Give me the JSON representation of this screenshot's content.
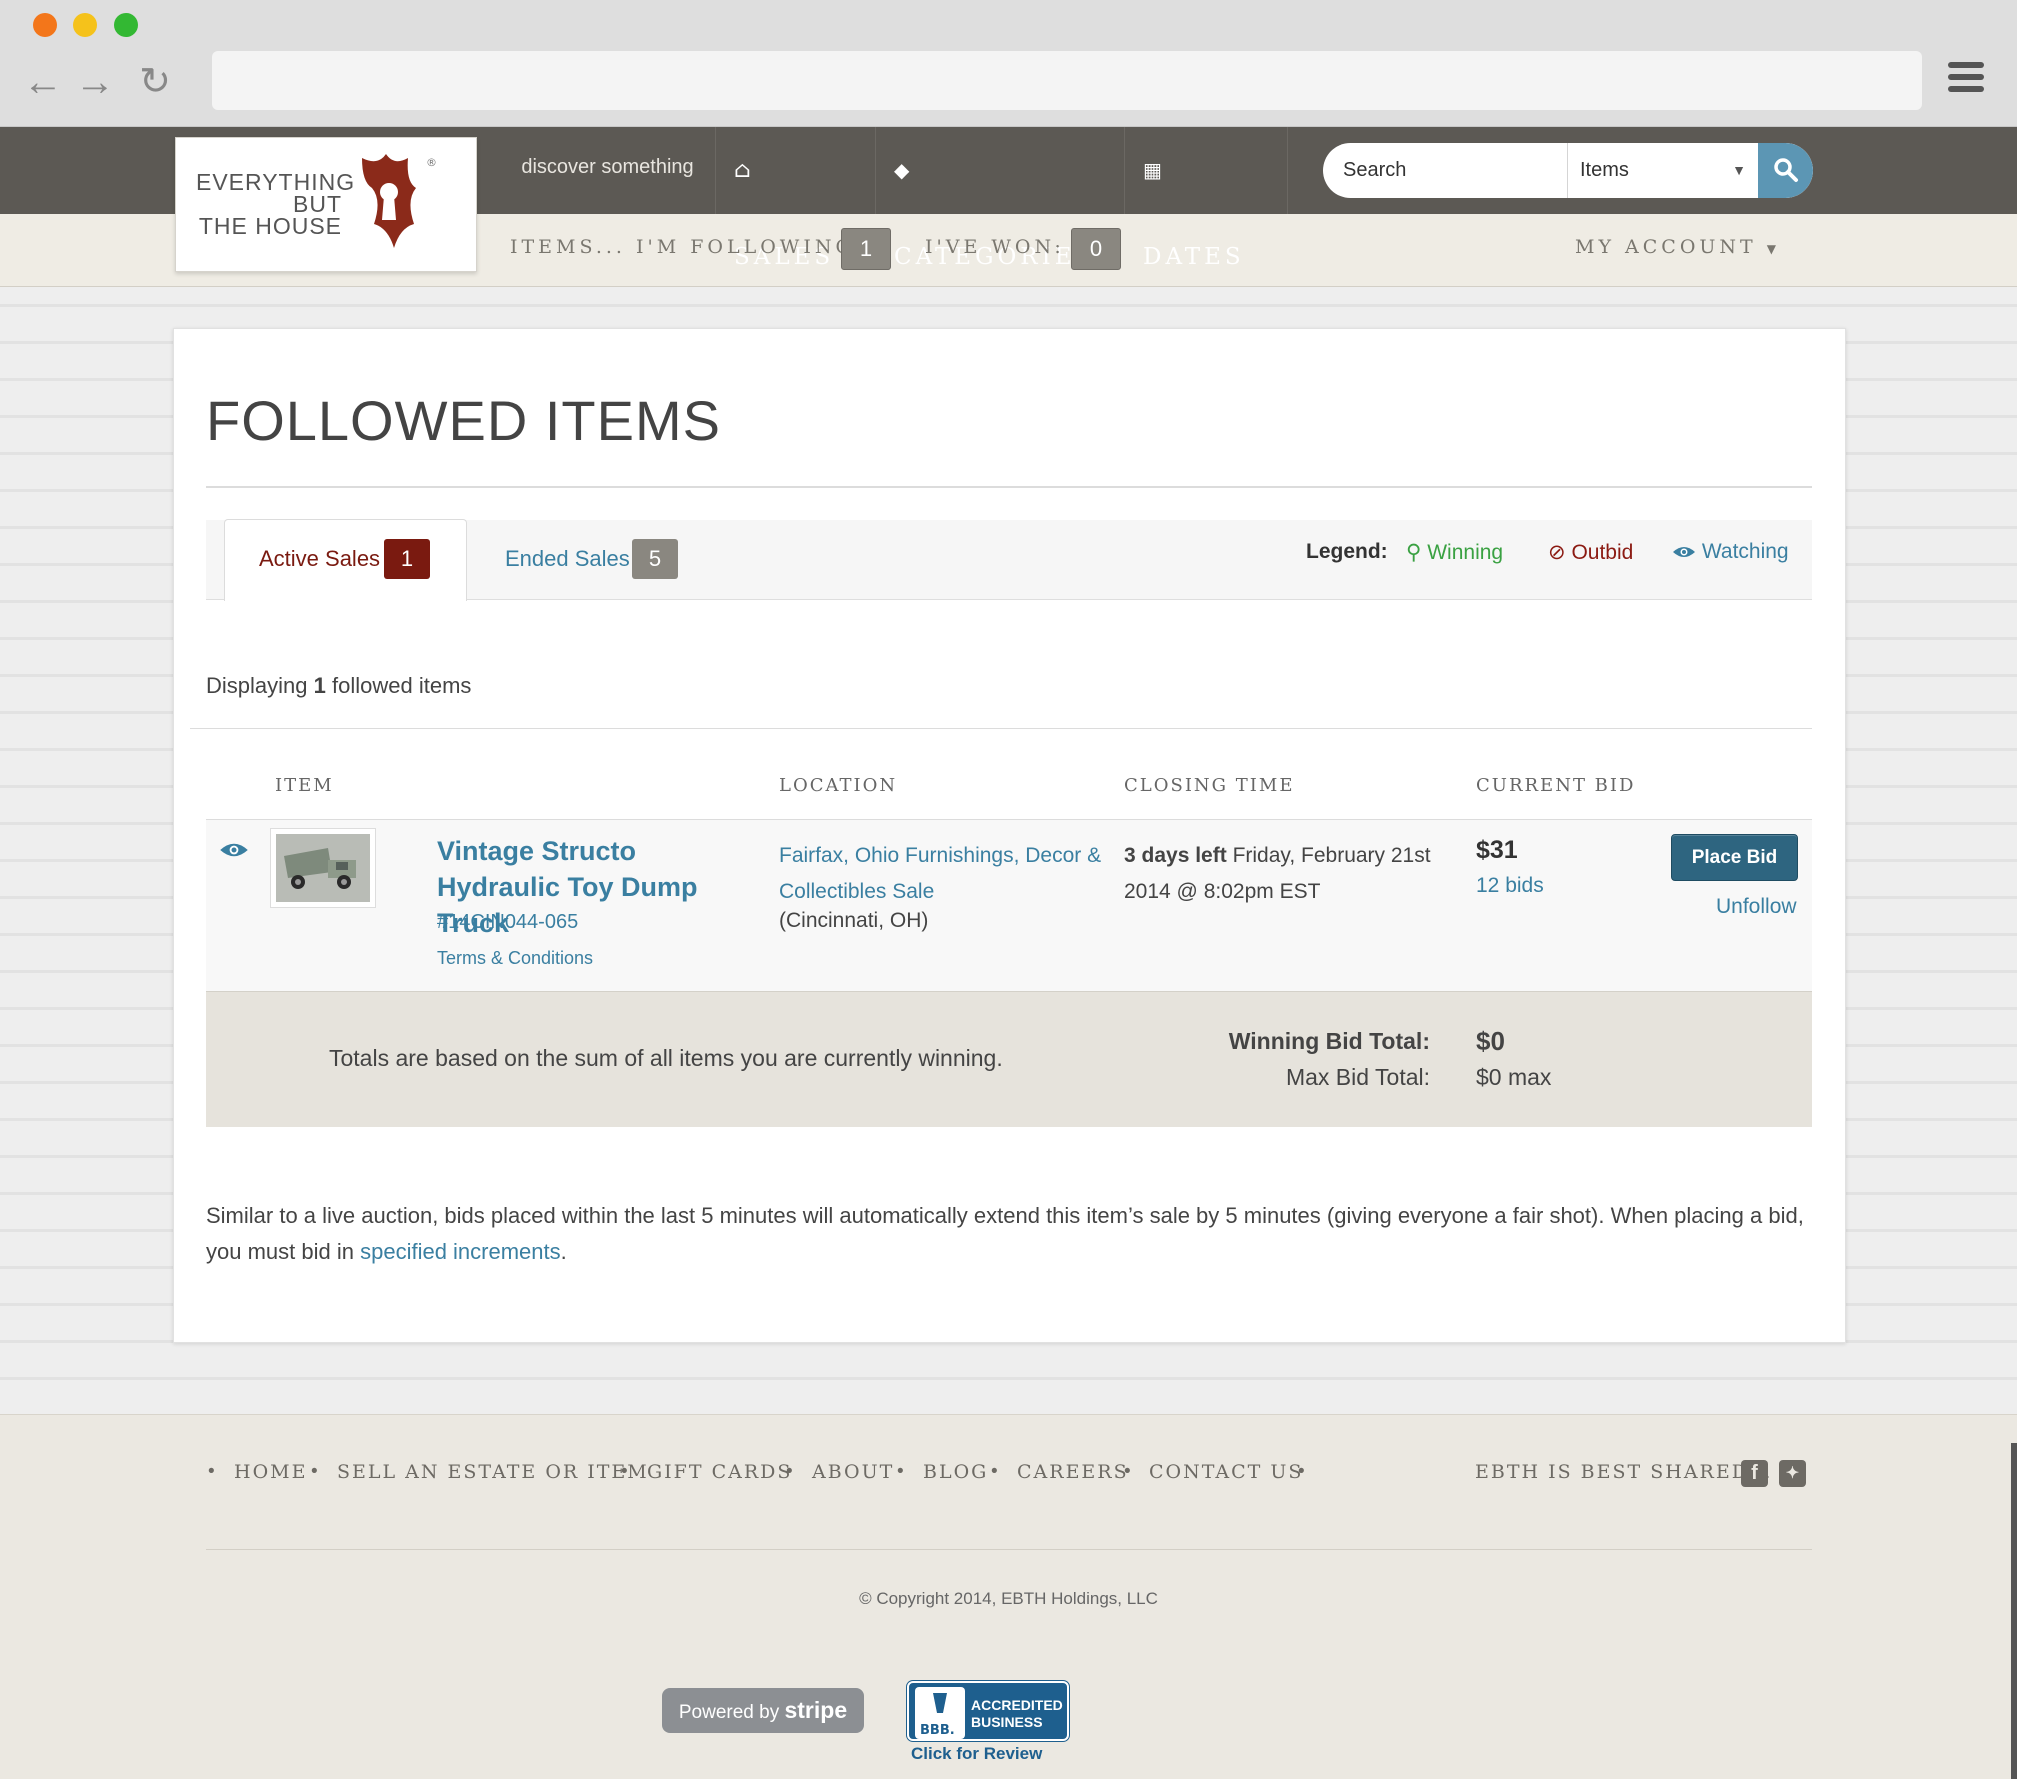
{
  "site": {
    "logo_lines": [
      "EVERYTHING",
      "BUT",
      "THE HOUSE"
    ],
    "tagline": "discover something",
    "nav": [
      {
        "label": "SALES",
        "icon": "home-icon"
      },
      {
        "label": "CATEGORIES",
        "icon": "tag-icon"
      },
      {
        "label": "DATES",
        "icon": "calendar-icon"
      }
    ],
    "search": {
      "placeholder": "Search",
      "scope": "Items"
    },
    "subnav": {
      "following_label": "ITEMS... I'M FOLLOWING:",
      "following_count": "1",
      "won_label": "I'VE WON:",
      "won_count": "0",
      "account_label": "MY ACCOUNT"
    }
  },
  "page": {
    "title": "FOLLOWED ITEMS",
    "tabs": [
      {
        "label": "Active Sales",
        "count": "1"
      },
      {
        "label": "Ended Sales",
        "count": "5"
      }
    ],
    "legend": {
      "title": "Legend:",
      "winning": "Winning",
      "outbid": "Outbid",
      "watching": "Watching"
    },
    "display_prefix": "Displaying",
    "display_count": "1",
    "display_suffix": "followed items",
    "columns": [
      "ITEM",
      "LOCATION",
      "CLOSING TIME",
      "CURRENT BID"
    ],
    "item": {
      "title": "Vintage Structo Hydraulic Toy Dump Truck",
      "lot": "#14CIN044-065",
      "terms": "Terms & Conditions",
      "sale_link": "Fairfax, Ohio Furnishings, Decor & Collectibles Sale",
      "sale_city": "(Cincinnati, OH)",
      "time_left": "3 days left",
      "closing": "Friday, February 21st 2014 @ 8:02pm EST",
      "current_bid": "$31",
      "bids": "12 bids",
      "place_bid": "Place Bid",
      "unfollow": "Unfollow"
    },
    "totals": {
      "note": "Totals are based on the sum of all items you are currently winning.",
      "winning_label": "Winning Bid Total:",
      "winning_value": "$0",
      "max_label": "Max Bid Total:",
      "max_value": "$0 max"
    },
    "footnote_text": "Similar to a live auction, bids placed within the last 5 minutes will automatically extend this item’s sale by 5 minutes (giving everyone a fair shot). When placing a bid, you must bid in",
    "footnote_link": "specified increments",
    "footnote_end": "."
  },
  "footer": {
    "links": [
      "HOME",
      "SELL AN ESTATE OR ITEM",
      "GIFT CARDS",
      "ABOUT",
      "BLOG",
      "CAREERS",
      "CONTACT US"
    ],
    "shared": "EBTH IS BEST SHARED...",
    "copyright": "© Copyright 2014, EBTH Holdings, LLC",
    "stripe_powered": "Powered by",
    "stripe_brand": "stripe",
    "bbb_line1": "ACCREDITED",
    "bbb_line2": "BUSINESS",
    "bbb_cta": "Click for Review"
  },
  "colors": {
    "brand_red": "#8b2a1a",
    "link_blue": "#3a7fa1",
    "winning_green": "#3aa142",
    "outbid_red": "#8b1a12",
    "header_gray": "#5c5954"
  }
}
